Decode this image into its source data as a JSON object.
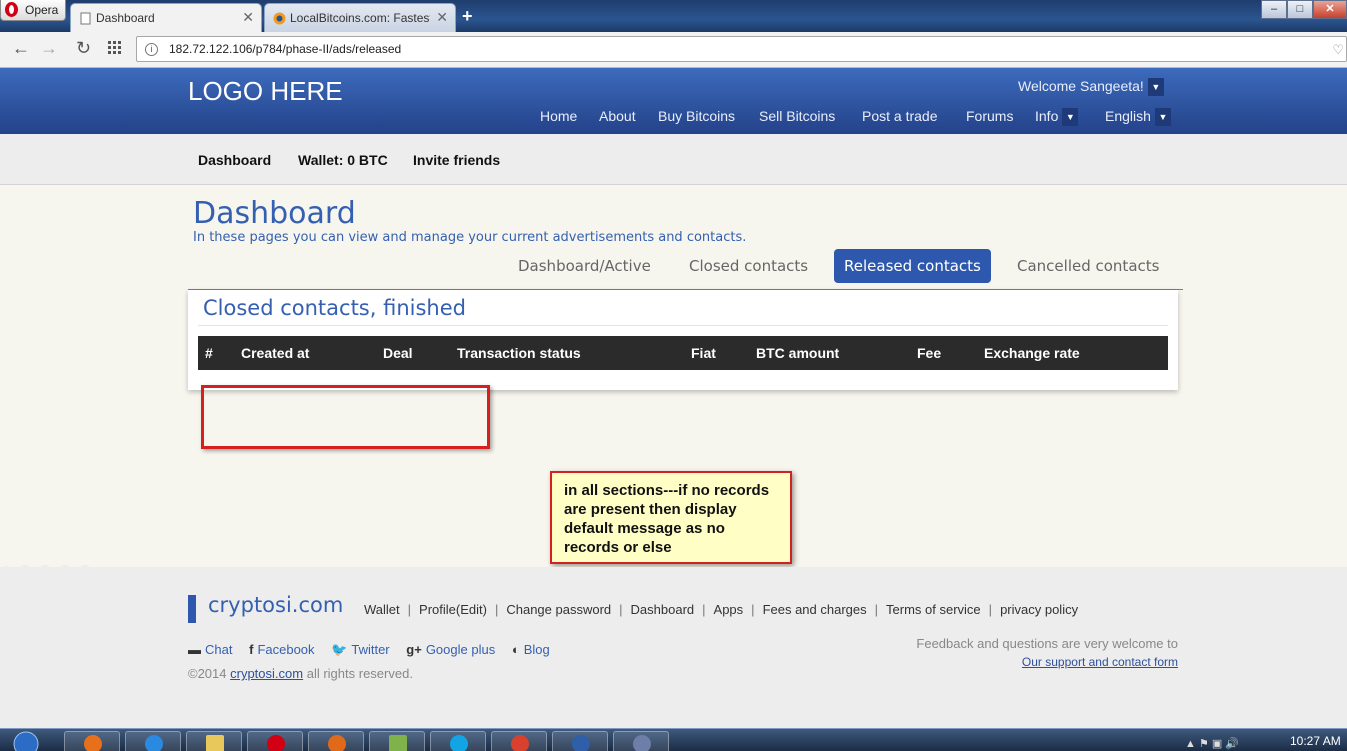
{
  "browser": {
    "opera_label": "Opera",
    "tabs": [
      {
        "label": "Dashboard",
        "close": "✕"
      },
      {
        "label": "LocalBitcoins.com: Fastest",
        "close": "✕"
      }
    ],
    "new_tab": "+",
    "url": "182.72.122.106/p784/phase-II/ads/released",
    "window_buttons": {
      "minimize": "–",
      "maximize": "□",
      "close": "✕"
    }
  },
  "header": {
    "logo": "LOGO HERE",
    "welcome": "Welcome Sangeeta!",
    "nav": [
      {
        "label": "Home"
      },
      {
        "label": "About"
      },
      {
        "label": "Buy Bitcoins"
      },
      {
        "label": "Sell Bitcoins"
      },
      {
        "label": "Post a trade"
      },
      {
        "label": "Forums"
      },
      {
        "label": "Info"
      },
      {
        "label": "English"
      }
    ]
  },
  "subnav": {
    "dashboard": "Dashboard",
    "wallet": "Wallet: 0 BTC",
    "invite": "Invite friends"
  },
  "main": {
    "title": "Dashboard",
    "description": "In these pages you can view and manage your current advertisements and contacts.",
    "tabs": [
      {
        "label": "Dashboard/Active",
        "active": false
      },
      {
        "label": "Closed contacts",
        "active": false
      },
      {
        "label": "Released contacts",
        "active": true
      },
      {
        "label": "Cancelled contacts",
        "active": false
      }
    ],
    "panel_title": "Closed contacts, finished",
    "columns": [
      "#",
      "Created at",
      "Deal",
      "Transaction status",
      "Fiat",
      "BTC amount",
      "Fee",
      "Exchange rate"
    ],
    "rows": []
  },
  "annotation": {
    "note": "in all sections---if no records are present then display default message as no records or else"
  },
  "footer": {
    "brand": "cryptosi.com",
    "links": [
      "Wallet",
      "Profile(Edit)",
      "Change password",
      "Dashboard",
      "Apps",
      "Fees and charges",
      "Terms of service",
      "privacy policy"
    ],
    "social": [
      {
        "icon": "▬",
        "label": "Chat"
      },
      {
        "icon": "f",
        "label": "Facebook"
      },
      {
        "icon": "🐦",
        "label": "Twitter"
      },
      {
        "icon": "g+",
        "label": "Google plus"
      },
      {
        "icon": "◐",
        "label": "Blog"
      }
    ],
    "copyright_prefix": "©2014",
    "copyright_link": "cryptosi.com",
    "copyright_suffix": "all rights reserved.",
    "feedback": "Feedback and questions are very welcome to",
    "support_link": "Our support and contact form"
  },
  "taskbar": {
    "clock": "10:27 AM"
  },
  "colors": {
    "brand_blue": "#2e58ad",
    "header_blue": "#2b4e98",
    "annotation_red": "#d81f1f",
    "note_bg": "#ffffc5"
  }
}
